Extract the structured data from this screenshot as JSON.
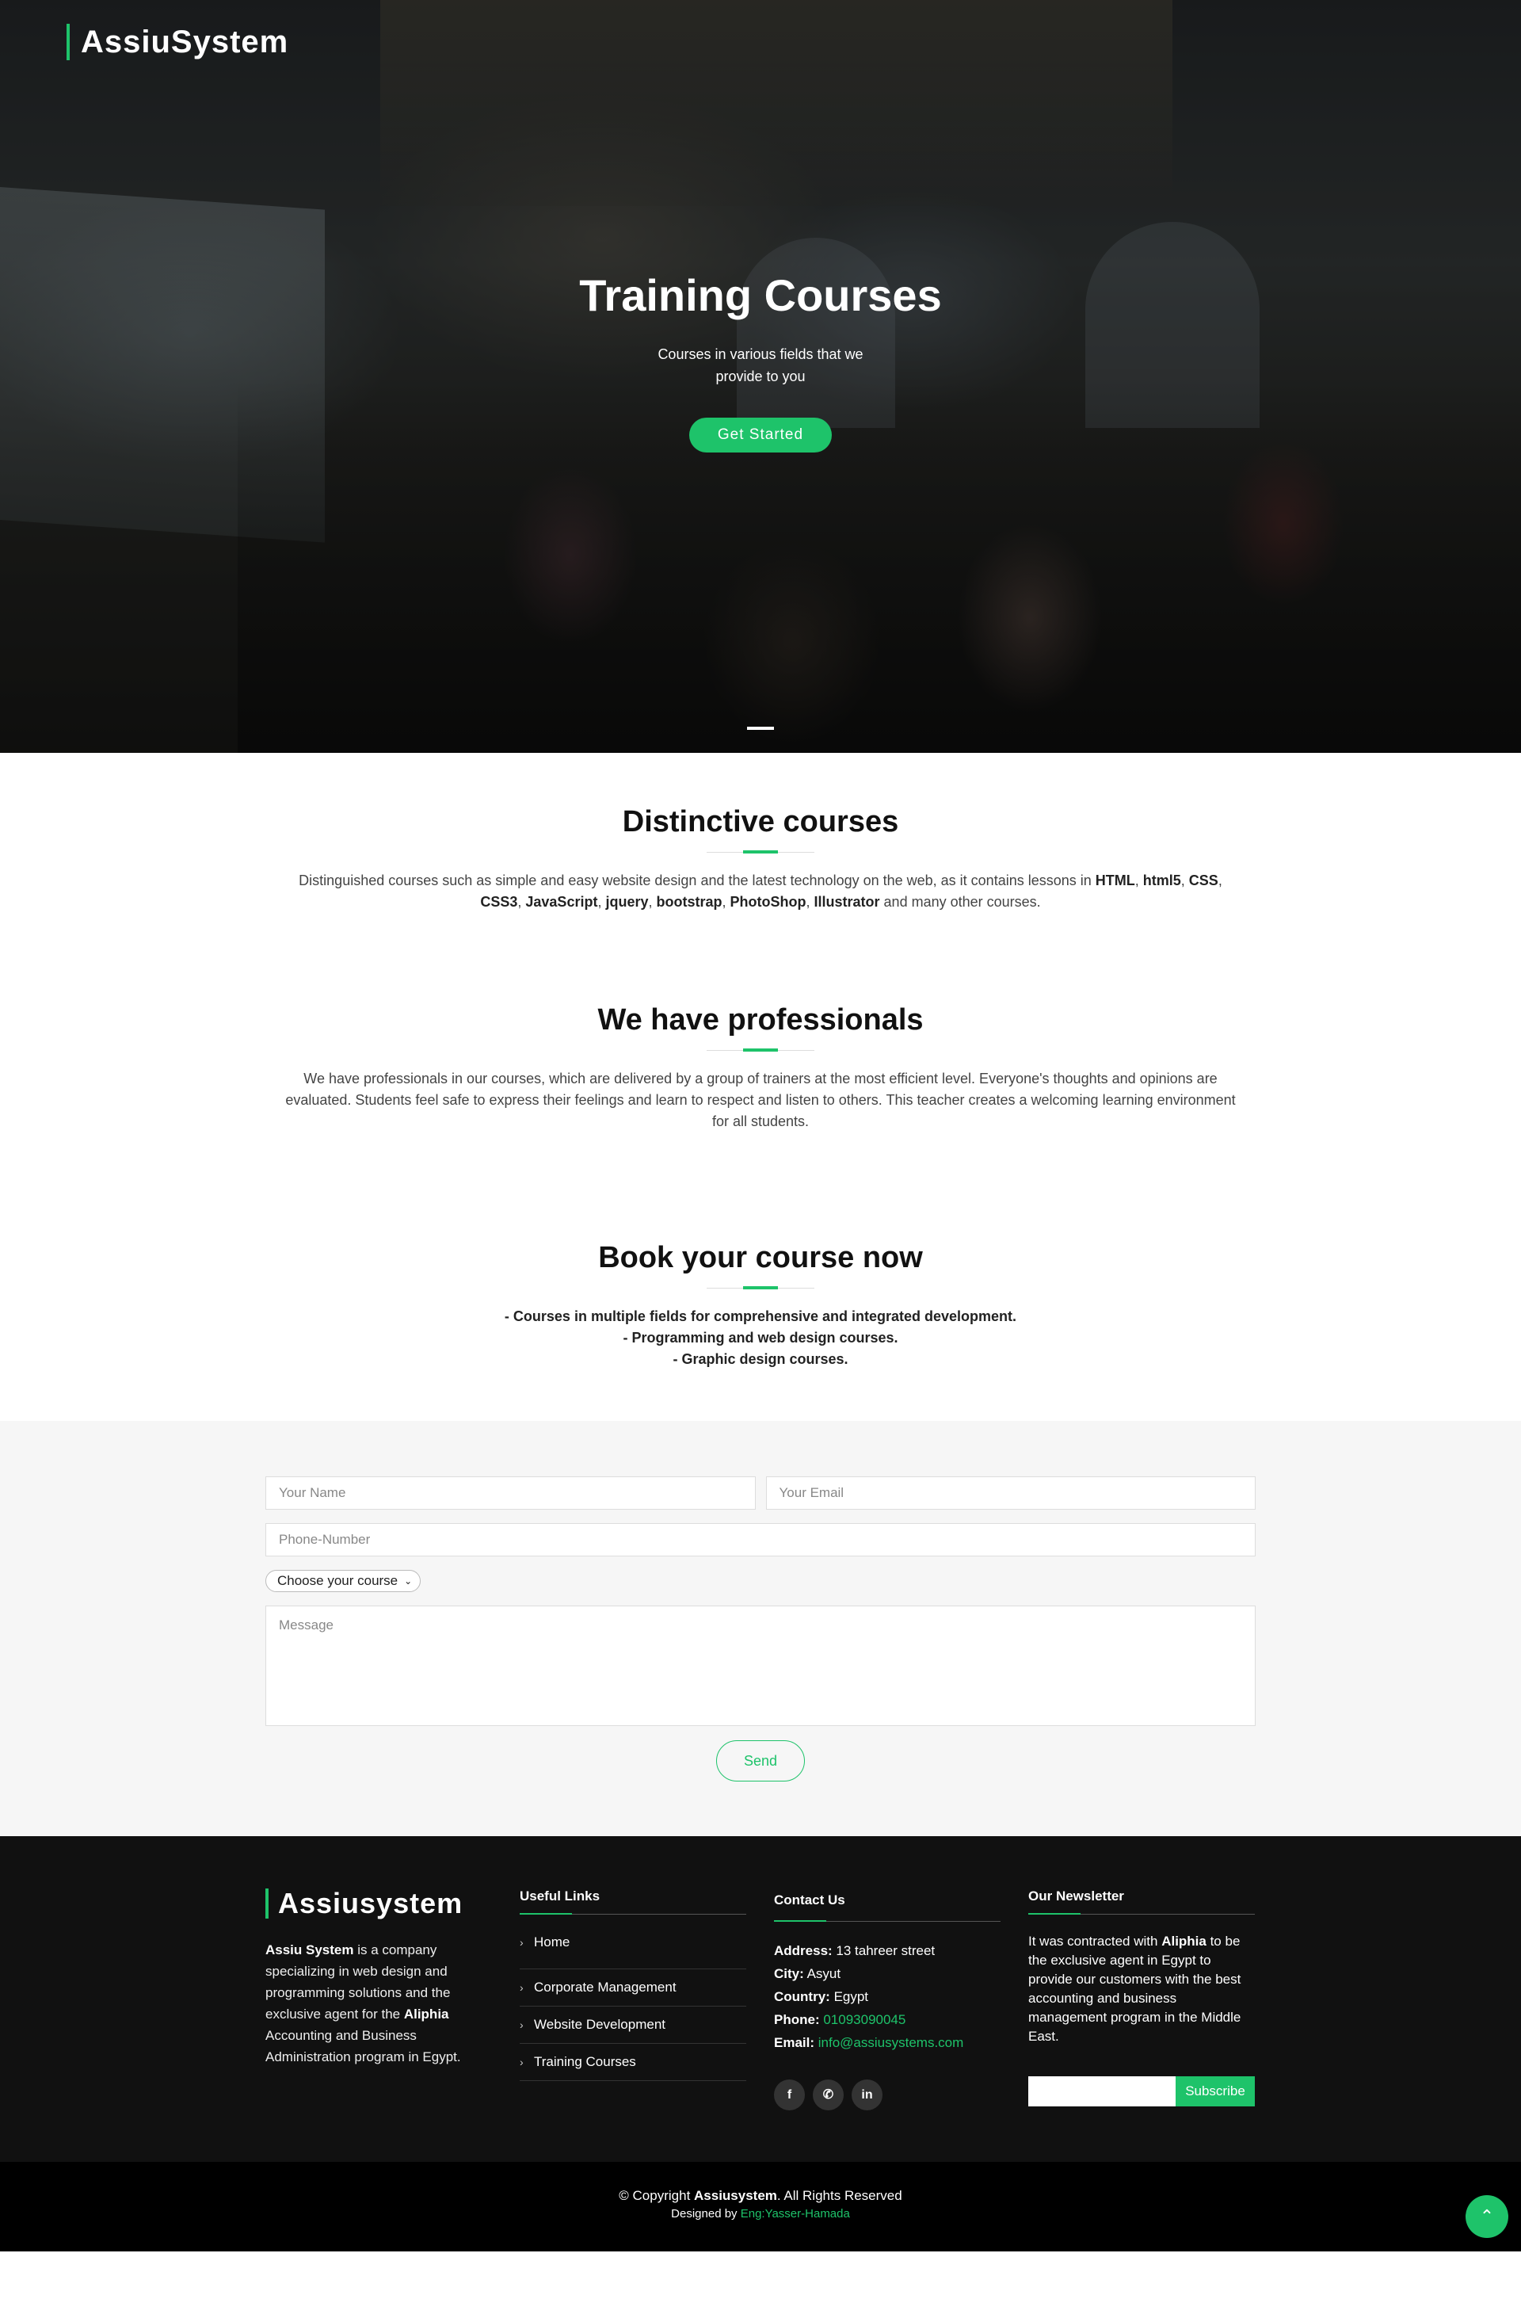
{
  "brand": "AssiuSystem",
  "hero": {
    "title": "Training Courses",
    "subtitle": "Courses in various fields that we provide to you",
    "cta": "Get Started"
  },
  "sections": {
    "distinctive": {
      "title": "Distinctive courses",
      "text_start": "Distinguished courses such as simple and easy website design and the latest technology on the web, as it contains lessons in ",
      "tech": [
        "HTML",
        "html5",
        "CSS",
        "CSS3",
        "JavaScript",
        "jquery",
        "bootstrap",
        "PhotoShop",
        "Illustrator"
      ],
      "text_end": " and many other courses."
    },
    "professionals": {
      "title": "We have professionals",
      "text": "We have professionals in our courses, which are delivered by a group of trainers at the most efficient level. Everyone's thoughts and opinions are evaluated. Students feel safe to express their feelings and learn to respect and listen to others. This teacher creates a welcoming learning environment for all students."
    },
    "book": {
      "title": "Book your course now",
      "lines": [
        "- Courses in multiple fields for comprehensive and integrated development.",
        "- Programming and web design courses.",
        "- Graphic design courses."
      ]
    }
  },
  "form": {
    "name_placeholder": "Your Name",
    "email_placeholder": "Your Email",
    "phone_placeholder": "Phone-Number",
    "course_select": "Choose your course",
    "message_placeholder": "Message",
    "send": "Send"
  },
  "footer": {
    "brand": "Assiusystem",
    "about_company": "Assiu System",
    "about_mid": " is a company specializing in web design and programming solutions and the exclusive agent for the ",
    "about_partner": "Aliphia",
    "about_end": " Accounting and Business Administration program in Egypt.",
    "links_title": "Useful Links",
    "links": [
      "Home",
      "Corporate Management",
      "Website Development",
      "Training Courses"
    ],
    "contact_title": "Contact Us",
    "contact": {
      "address_label": "Address:",
      "address": "13 tahreer street",
      "city_label": "City:",
      "city": "Asyut",
      "country_label": "Country:",
      "country": "Egypt",
      "phone_label": "Phone:",
      "phone": "01093090045",
      "email_label": "Email:",
      "email": "info@assiusystems.com"
    },
    "social": [
      "facebook-icon",
      "whatsapp-icon",
      "linkedin-icon"
    ],
    "newsletter_title": "Our Newsletter",
    "newsletter_start": "It was contracted with ",
    "newsletter_partner": "Aliphia",
    "newsletter_end": " to be the exclusive agent in Egypt to provide our customers with the best accounting and business management program in the Middle East.",
    "subscribe": "Subscribe"
  },
  "copyright": {
    "prefix": "© Copyright ",
    "name": "Assiusystem",
    "suffix": ". All Rights Reserved",
    "designed_by": "Designed by ",
    "designer": "Eng:Yasser-Hamada"
  },
  "colors": {
    "accent": "#1ec36a",
    "footer_bg": "#111111"
  }
}
